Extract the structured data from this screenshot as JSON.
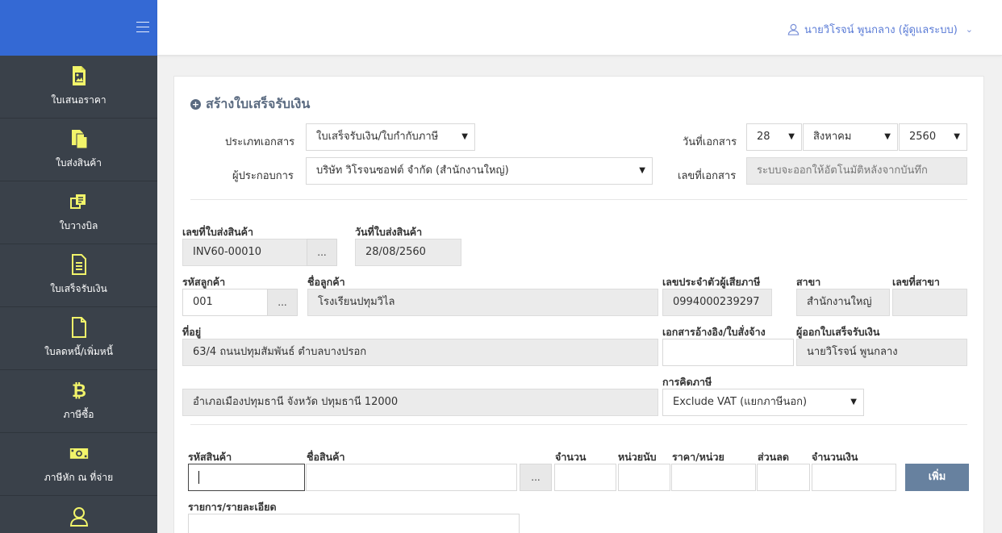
{
  "sidebar": {
    "items": [
      {
        "label": "ใบเสนอราคา",
        "icon": "image-file-icon"
      },
      {
        "label": "ใบส่งสินค้า",
        "icon": "copy-files-icon"
      },
      {
        "label": "ใบวางบิล",
        "icon": "clone-icon"
      },
      {
        "label": "ใบเสร็จรับเงิน",
        "icon": "document-text-icon"
      },
      {
        "label": "ใบลดหนี้/เพิ่มหนี้",
        "icon": "blank-file-icon"
      },
      {
        "label": "ภาษีซื้อ",
        "icon": "bitcoin-icon"
      },
      {
        "label": "ภาษีหัก ณ ที่จ่าย",
        "icon": "money-bill-icon"
      },
      {
        "label": "",
        "icon": "user-outline-icon"
      }
    ]
  },
  "header": {
    "user": "นายวิโรจน์ พูนกลาง (ผู้ดูแลระบบ)"
  },
  "form": {
    "title": "สร้างใบเสร็จรับเงิน",
    "doc_type_label": "ประเภทเอกสาร",
    "doc_type_value": "ใบเสร็จรับเงิน/ใบกำกับภาษี",
    "operator_label": "ผู้ประกอบการ",
    "operator_value": "บริษัท วิโรจนซอฟต์ จำกัด (สำนักงานใหญ่)",
    "doc_date_label": "วันที่เอกสาร",
    "doc_day": "28",
    "doc_month": "สิงหาคม",
    "doc_year": "2560",
    "doc_no_label": "เลขที่เอกสาร",
    "doc_no_placeholder": "ระบบจะออกให้อัตโนมัติหลังจากบันทึก",
    "invoice_no_label": "เลขที่ใบส่งสินค้า",
    "invoice_no_value": "INV60-00010",
    "invoice_date_label": "วันที่ใบส่งสินค้า",
    "invoice_date_value": "28/08/2560",
    "customer_code_label": "รหัสลูกค้า",
    "customer_code_value": "001",
    "customer_name_label": "ชื่อลูกค้า",
    "customer_name_value": "โรงเรียนปทุมวิไล",
    "tax_id_label": "เลขประจำตัวผู้เสียภาษี",
    "tax_id_value": "0994000239297",
    "branch_label": "สาขา",
    "branch_value": "สำนักงานใหญ่",
    "branch_no_label": "เลขที่สาขา",
    "branch_no_value": "",
    "address_label": "ที่อยู่",
    "address_line1": "63/4 ถนนปทุมสัมพันธ์ ตำบลบางปรอก",
    "address_line2": "อำเภอเมืองปทุมธานี จังหวัด ปทุมธานี 12000",
    "ref_doc_label": "เอกสารอ้างอิง/ใบสั่งจ้าง",
    "ref_doc_value": "",
    "issuer_label": "ผู้ออกใบเสร็จรับเงิน",
    "issuer_value": "นายวิโรจน์ พูนกลาง",
    "tax_calc_label": "การคิดภาษี",
    "tax_calc_value": "Exclude VAT (แยกภาษีนอก)",
    "dots": "..."
  },
  "items": {
    "code_label": "รหัสสินค้า",
    "name_label": "ชื่อสินค้า",
    "qty_label": "จำนวน",
    "unit_label": "หน่วยนับ",
    "price_label": "ราคา/หน่วย",
    "discount_label": "ส่วนลด",
    "amount_label": "จำนวนเงิน",
    "add_button": "เพิ่ม",
    "detail_label": "รายการ/รายละเอียด"
  }
}
